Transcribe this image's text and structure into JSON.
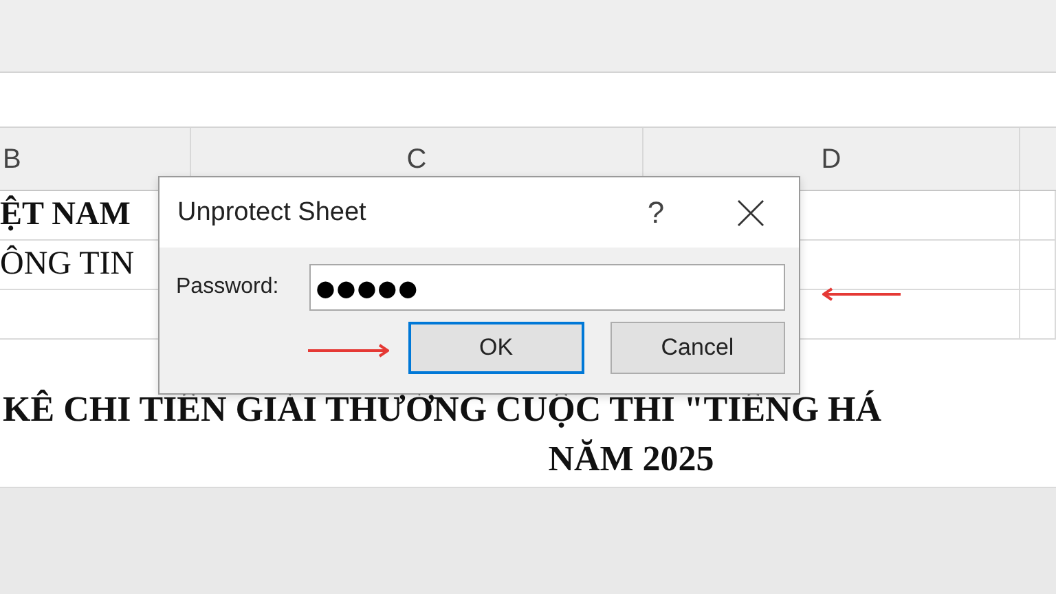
{
  "columns": [
    {
      "label": "B"
    },
    {
      "label": "C"
    },
    {
      "label": "D"
    }
  ],
  "cells": [
    {
      "text": "ỆT NAM",
      "bold": true
    },
    {
      "text": "ÔNG TIN",
      "bold": false
    }
  ],
  "title_lines": [
    "KÊ CHI TIỀN GIẢI THƯỞNG CUỘC THI \"TIẾNG HÁ",
    "NĂM 2025"
  ],
  "dialog": {
    "title": "Unprotect Sheet",
    "help": "?",
    "password_label": "Password:",
    "password_value": "●●●●●",
    "buttons": [
      {
        "label": "OK",
        "selected": true
      },
      {
        "label": "Cancel",
        "selected": false
      }
    ]
  }
}
